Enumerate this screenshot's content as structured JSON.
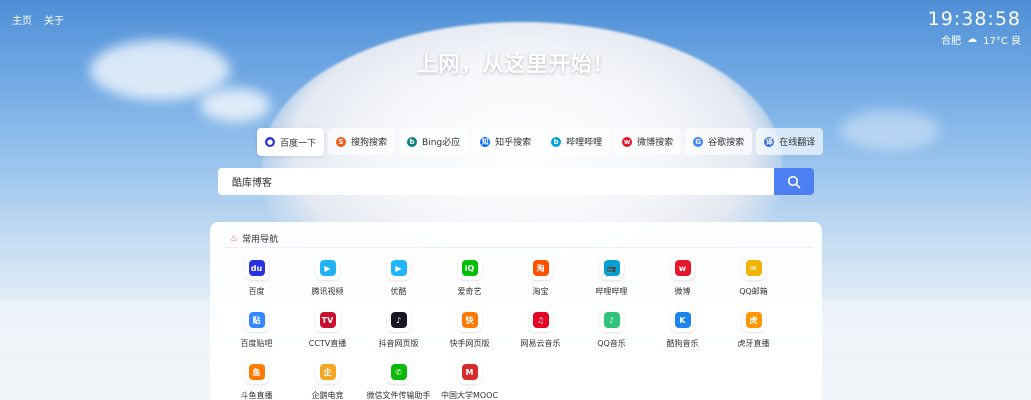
{
  "topnav": {
    "home": "主页",
    "about": "关于"
  },
  "clock": {
    "time": "19:38:58",
    "city": "合肥",
    "weather": "17°C 良"
  },
  "slogan": "上网，从这里开始！",
  "engines": [
    {
      "label": "百度一下",
      "icon": "paw-icon",
      "color": "#2932e1",
      "glyph": "●",
      "active": true
    },
    {
      "label": "搜狗搜索",
      "icon": "sogou-icon",
      "color": "#f25c19",
      "glyph": "S"
    },
    {
      "label": "Bing必应",
      "icon": "bing-icon",
      "color": "#0c8484",
      "glyph": "b"
    },
    {
      "label": "知乎搜索",
      "icon": "zhihu-icon",
      "color": "#0066ff",
      "glyph": "知"
    },
    {
      "label": "哔哩哔哩",
      "icon": "bilibili-icon",
      "color": "#00a1d6",
      "glyph": "b"
    },
    {
      "label": "微博搜索",
      "icon": "weibo-icon",
      "color": "#e6162d",
      "glyph": "w"
    },
    {
      "label": "谷歌搜索",
      "icon": "google-icon",
      "color": "#4285f4",
      "glyph": "G"
    },
    {
      "label": "在线翻译",
      "icon": "translate-icon",
      "color": "#3a6fd8",
      "glyph": "译"
    }
  ],
  "search": {
    "value": "酷库博客",
    "placeholder": ""
  },
  "panel": {
    "title": "常用导航"
  },
  "sites": [
    {
      "name": "百度",
      "icon": "baidu-icon",
      "color": "#2932e1",
      "glyph": "du"
    },
    {
      "name": "腾讯视频",
      "icon": "tencent-video-icon",
      "color": "#20b2f5",
      "glyph": "▶"
    },
    {
      "name": "优酷",
      "icon": "youku-icon",
      "color": "#1fb6ff",
      "glyph": "▶"
    },
    {
      "name": "爱奇艺",
      "icon": "iqiyi-icon",
      "color": "#00be06",
      "glyph": "iQ"
    },
    {
      "name": "淘宝",
      "icon": "taobao-icon",
      "color": "#ff5000",
      "glyph": "淘"
    },
    {
      "name": "哔哩哔哩",
      "icon": "bilibili-tv-icon",
      "color": "#00a1d6",
      "glyph": "📺"
    },
    {
      "name": "微博",
      "icon": "weibo-icon",
      "color": "#e6162d",
      "glyph": "w"
    },
    {
      "name": "QQ邮箱",
      "icon": "qqmail-icon",
      "color": "#f0b400",
      "glyph": "✉"
    },
    {
      "name": "百度贴吧",
      "icon": "tieba-icon",
      "color": "#3388ff",
      "glyph": "贴"
    },
    {
      "name": "CCTV直播",
      "icon": "cctv-icon",
      "color": "#c8102e",
      "glyph": "TV"
    },
    {
      "name": "抖音网页版",
      "icon": "douyin-icon",
      "color": "#161823",
      "glyph": "♪"
    },
    {
      "name": "快手网页版",
      "icon": "kuaishou-icon",
      "color": "#ff7a00",
      "glyph": "快"
    },
    {
      "name": "网易云音乐",
      "icon": "netease-music-icon",
      "color": "#e60026",
      "glyph": "♫"
    },
    {
      "name": "QQ音乐",
      "icon": "qqmusic-icon",
      "color": "#31c27c",
      "glyph": "♪"
    },
    {
      "name": "酷狗音乐",
      "icon": "kugou-icon",
      "color": "#1c86ee",
      "glyph": "K"
    },
    {
      "name": "虎牙直播",
      "icon": "huya-icon",
      "color": "#ff9600",
      "glyph": "虎"
    },
    {
      "name": "斗鱼直播",
      "icon": "douyu-icon",
      "color": "#ff7a00",
      "glyph": "鱼"
    },
    {
      "name": "企鹅电竞",
      "icon": "penguin-esports-icon",
      "color": "#f5a623",
      "glyph": "企"
    },
    {
      "name": "微信文件传输助手",
      "icon": "wechat-icon",
      "color": "#09bb07",
      "glyph": "✆"
    },
    {
      "name": "中国大学MOOC",
      "icon": "mooc-icon",
      "color": "#d92b2b",
      "glyph": "M"
    }
  ]
}
